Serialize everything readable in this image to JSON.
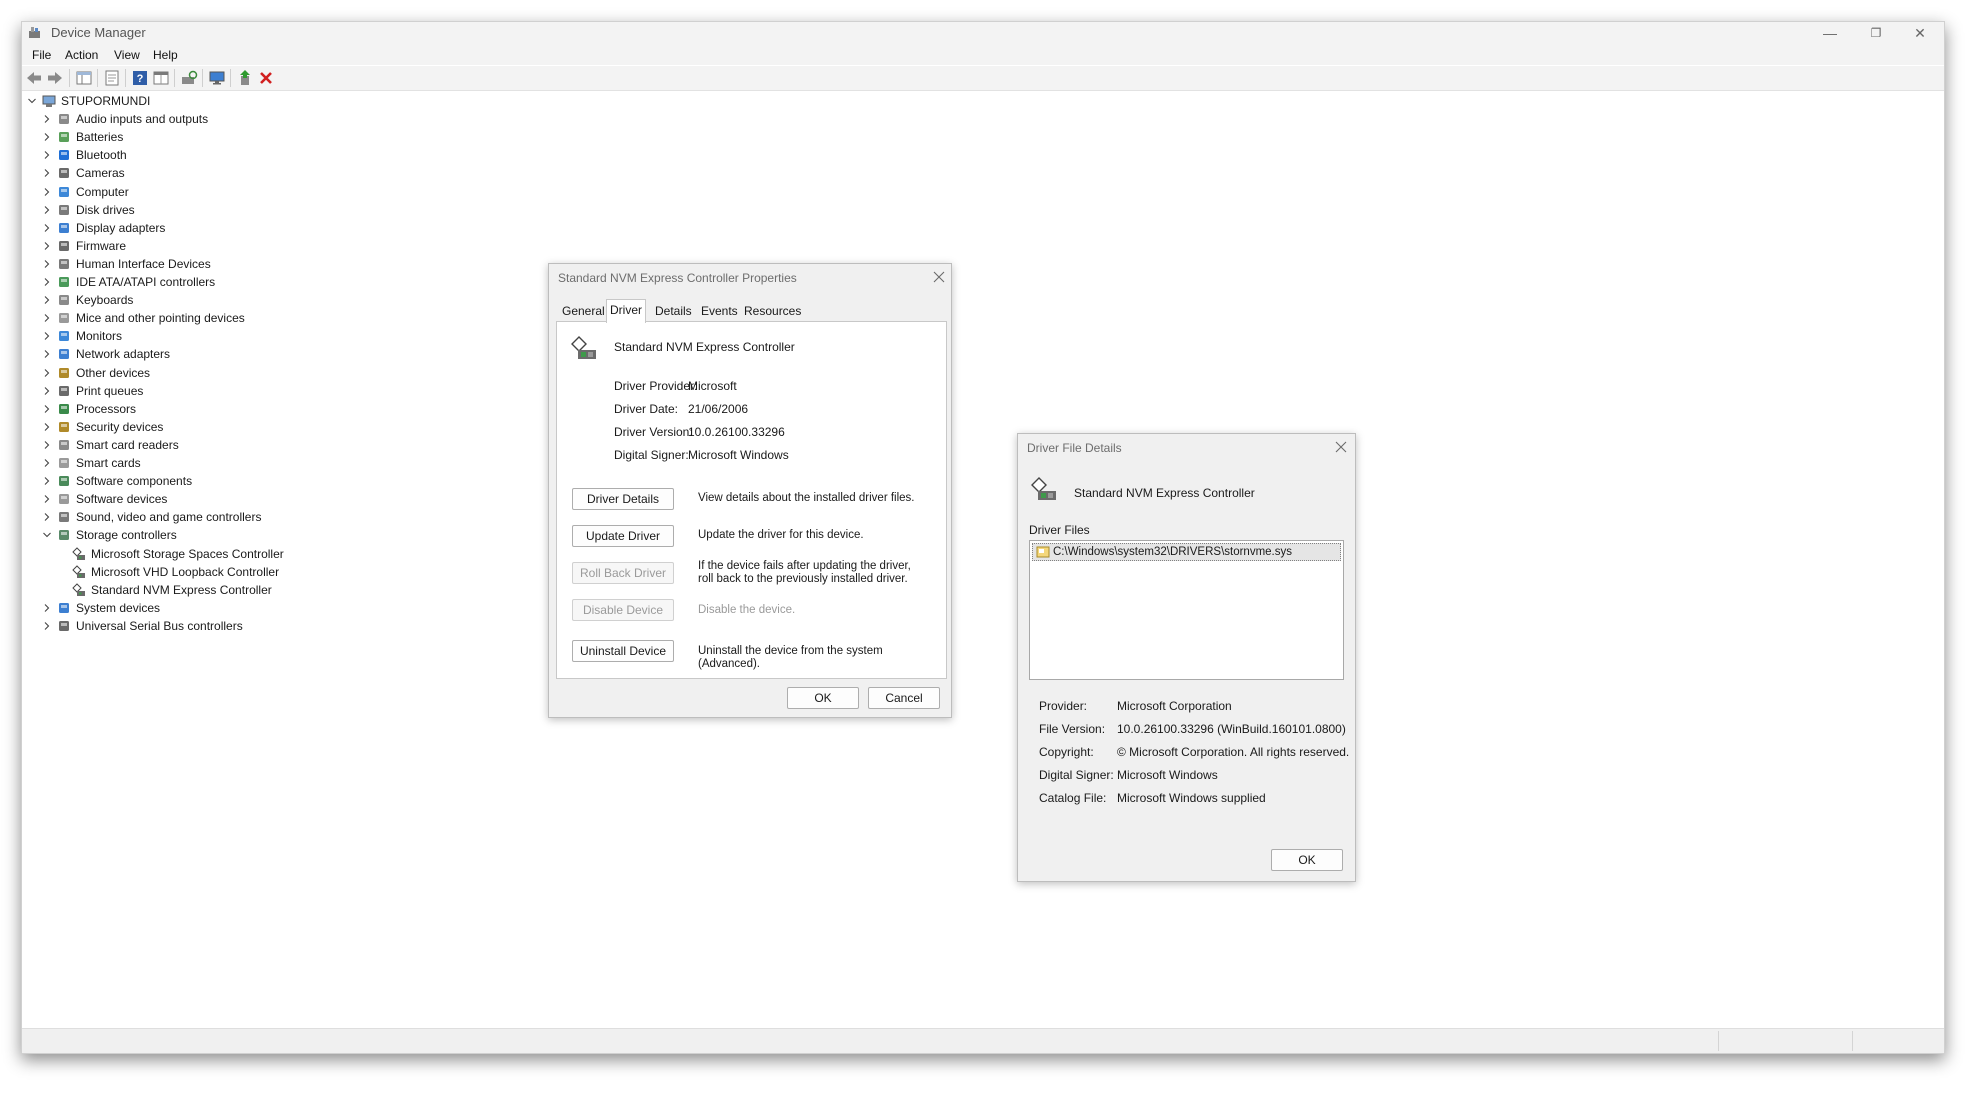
{
  "window": {
    "title": "Device Manager",
    "controls": {
      "minimize": "—",
      "maximize": "❐",
      "close": "✕"
    }
  },
  "menu": [
    "File",
    "Action",
    "View",
    "Help"
  ],
  "toolbar_icons": [
    "back-arrow-icon",
    "forward-arrow-icon",
    "show-hide-tree-icon",
    "properties-icon",
    "help-icon",
    "view-icon",
    "scan-hardware-icon",
    "monitor-icon",
    "add-driver-icon",
    "uninstall-x-icon"
  ],
  "tree": {
    "root": "STUPORMUNDI",
    "categories": [
      {
        "label": "Audio inputs and outputs",
        "icon": "speaker-icon"
      },
      {
        "label": "Batteries",
        "icon": "battery-icon"
      },
      {
        "label": "Bluetooth",
        "icon": "bluetooth-icon"
      },
      {
        "label": "Cameras",
        "icon": "camera-icon"
      },
      {
        "label": "Computer",
        "icon": "computer-icon"
      },
      {
        "label": "Disk drives",
        "icon": "disk-drive-icon"
      },
      {
        "label": "Display adapters",
        "icon": "display-adapter-icon"
      },
      {
        "label": "Firmware",
        "icon": "firmware-icon"
      },
      {
        "label": "Human Interface Devices",
        "icon": "hid-icon"
      },
      {
        "label": "IDE ATA/ATAPI controllers",
        "icon": "ide-controller-icon"
      },
      {
        "label": "Keyboards",
        "icon": "keyboard-icon"
      },
      {
        "label": "Mice and other pointing devices",
        "icon": "mouse-icon"
      },
      {
        "label": "Monitors",
        "icon": "monitor-icon"
      },
      {
        "label": "Network adapters",
        "icon": "network-adapter-icon"
      },
      {
        "label": "Other devices",
        "icon": "other-devices-icon"
      },
      {
        "label": "Print queues",
        "icon": "printer-icon"
      },
      {
        "label": "Processors",
        "icon": "processor-icon"
      },
      {
        "label": "Security devices",
        "icon": "security-device-icon"
      },
      {
        "label": "Smart card readers",
        "icon": "smart-card-reader-icon"
      },
      {
        "label": "Smart cards",
        "icon": "smart-card-icon"
      },
      {
        "label": "Software components",
        "icon": "software-component-icon"
      },
      {
        "label": "Software devices",
        "icon": "software-device-icon"
      },
      {
        "label": "Sound, video and game controllers",
        "icon": "sound-controller-icon"
      },
      {
        "label": "Storage controllers",
        "icon": "storage-controller-icon",
        "expanded": true
      },
      {
        "label": "Microsoft Storage Spaces Controller",
        "icon": "storage-device-icon",
        "child": true
      },
      {
        "label": "Microsoft VHD Loopback Controller",
        "icon": "storage-device-icon",
        "child": true
      },
      {
        "label": "Standard NVM Express Controller",
        "icon": "storage-device-icon",
        "child": true
      },
      {
        "label": "System devices",
        "icon": "system-device-icon"
      },
      {
        "label": "Universal Serial Bus controllers",
        "icon": "usb-icon"
      }
    ]
  },
  "properties": {
    "title": "Standard NVM Express Controller Properties",
    "tabs": [
      "General",
      "Driver",
      "Details",
      "Events",
      "Resources"
    ],
    "active_tab": "Driver",
    "device_name": "Standard NVM Express Controller",
    "fields": [
      {
        "label": "Driver Provider:",
        "value": "Microsoft"
      },
      {
        "label": "Driver Date:",
        "value": "21/06/2006"
      },
      {
        "label": "Driver Version:",
        "value": "10.0.26100.33296"
      },
      {
        "label": "Digital Signer:",
        "value": "Microsoft Windows"
      }
    ],
    "actions": [
      {
        "label": "Driver Details",
        "desc": "View details about the installed driver files.",
        "disabled": false
      },
      {
        "label": "Update Driver",
        "desc": "Update the driver for this device.",
        "disabled": false
      },
      {
        "label": "Roll Back Driver",
        "desc": "If the device fails after updating the driver, roll back to the previously installed driver.",
        "disabled": true
      },
      {
        "label": "Disable Device",
        "desc": "Disable the device.",
        "disabled": true
      },
      {
        "label": "Uninstall Device",
        "desc": "Uninstall the device from the system (Advanced).",
        "disabled": false
      }
    ],
    "ok": "OK",
    "cancel": "Cancel"
  },
  "file_details": {
    "title": "Driver File Details",
    "device_name": "Standard NVM Express Controller",
    "files_label": "Driver Files",
    "files": [
      "C:\\Windows\\system32\\DRIVERS\\stornvme.sys"
    ],
    "fields": [
      {
        "label": "Provider:",
        "value": "Microsoft Corporation"
      },
      {
        "label": "File Version:",
        "value": "10.0.26100.33296 (WinBuild.160101.0800)"
      },
      {
        "label": "Copyright:",
        "value": "© Microsoft Corporation. All rights reserved."
      },
      {
        "label": "Digital Signer:",
        "value": "Microsoft Windows"
      },
      {
        "label": "Catalog File:",
        "value": "Microsoft Windows supplied"
      }
    ],
    "ok": "OK"
  }
}
